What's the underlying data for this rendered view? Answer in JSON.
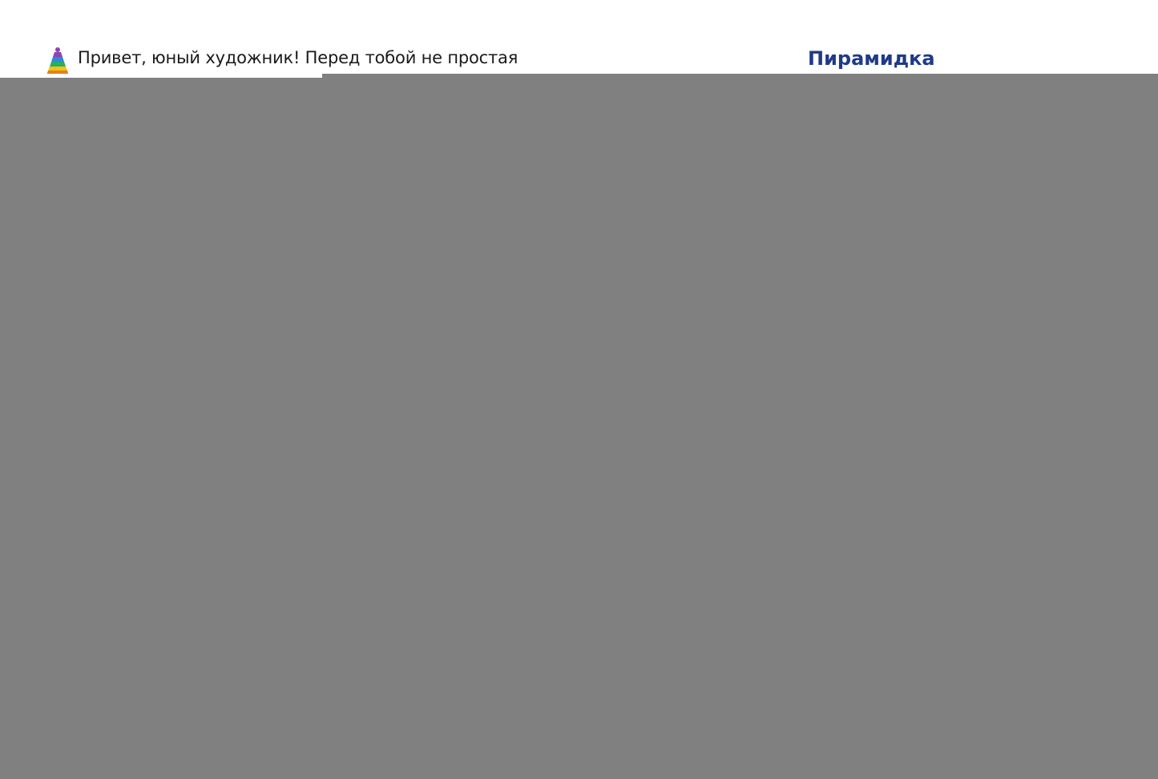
{
  "header": {
    "intro_text": "Привет, юный художник!  Перед тобой не простая",
    "title_link": "Пирамидка",
    "logo_icon": "pyramid-toy-icon"
  },
  "overlay": {
    "color": "#808080"
  },
  "colors": {
    "title": "#1f3a8a",
    "pyramid": [
      "#8e44ad",
      "#2e86de",
      "#27ae60",
      "#f1c40f",
      "#e67e22"
    ]
  }
}
